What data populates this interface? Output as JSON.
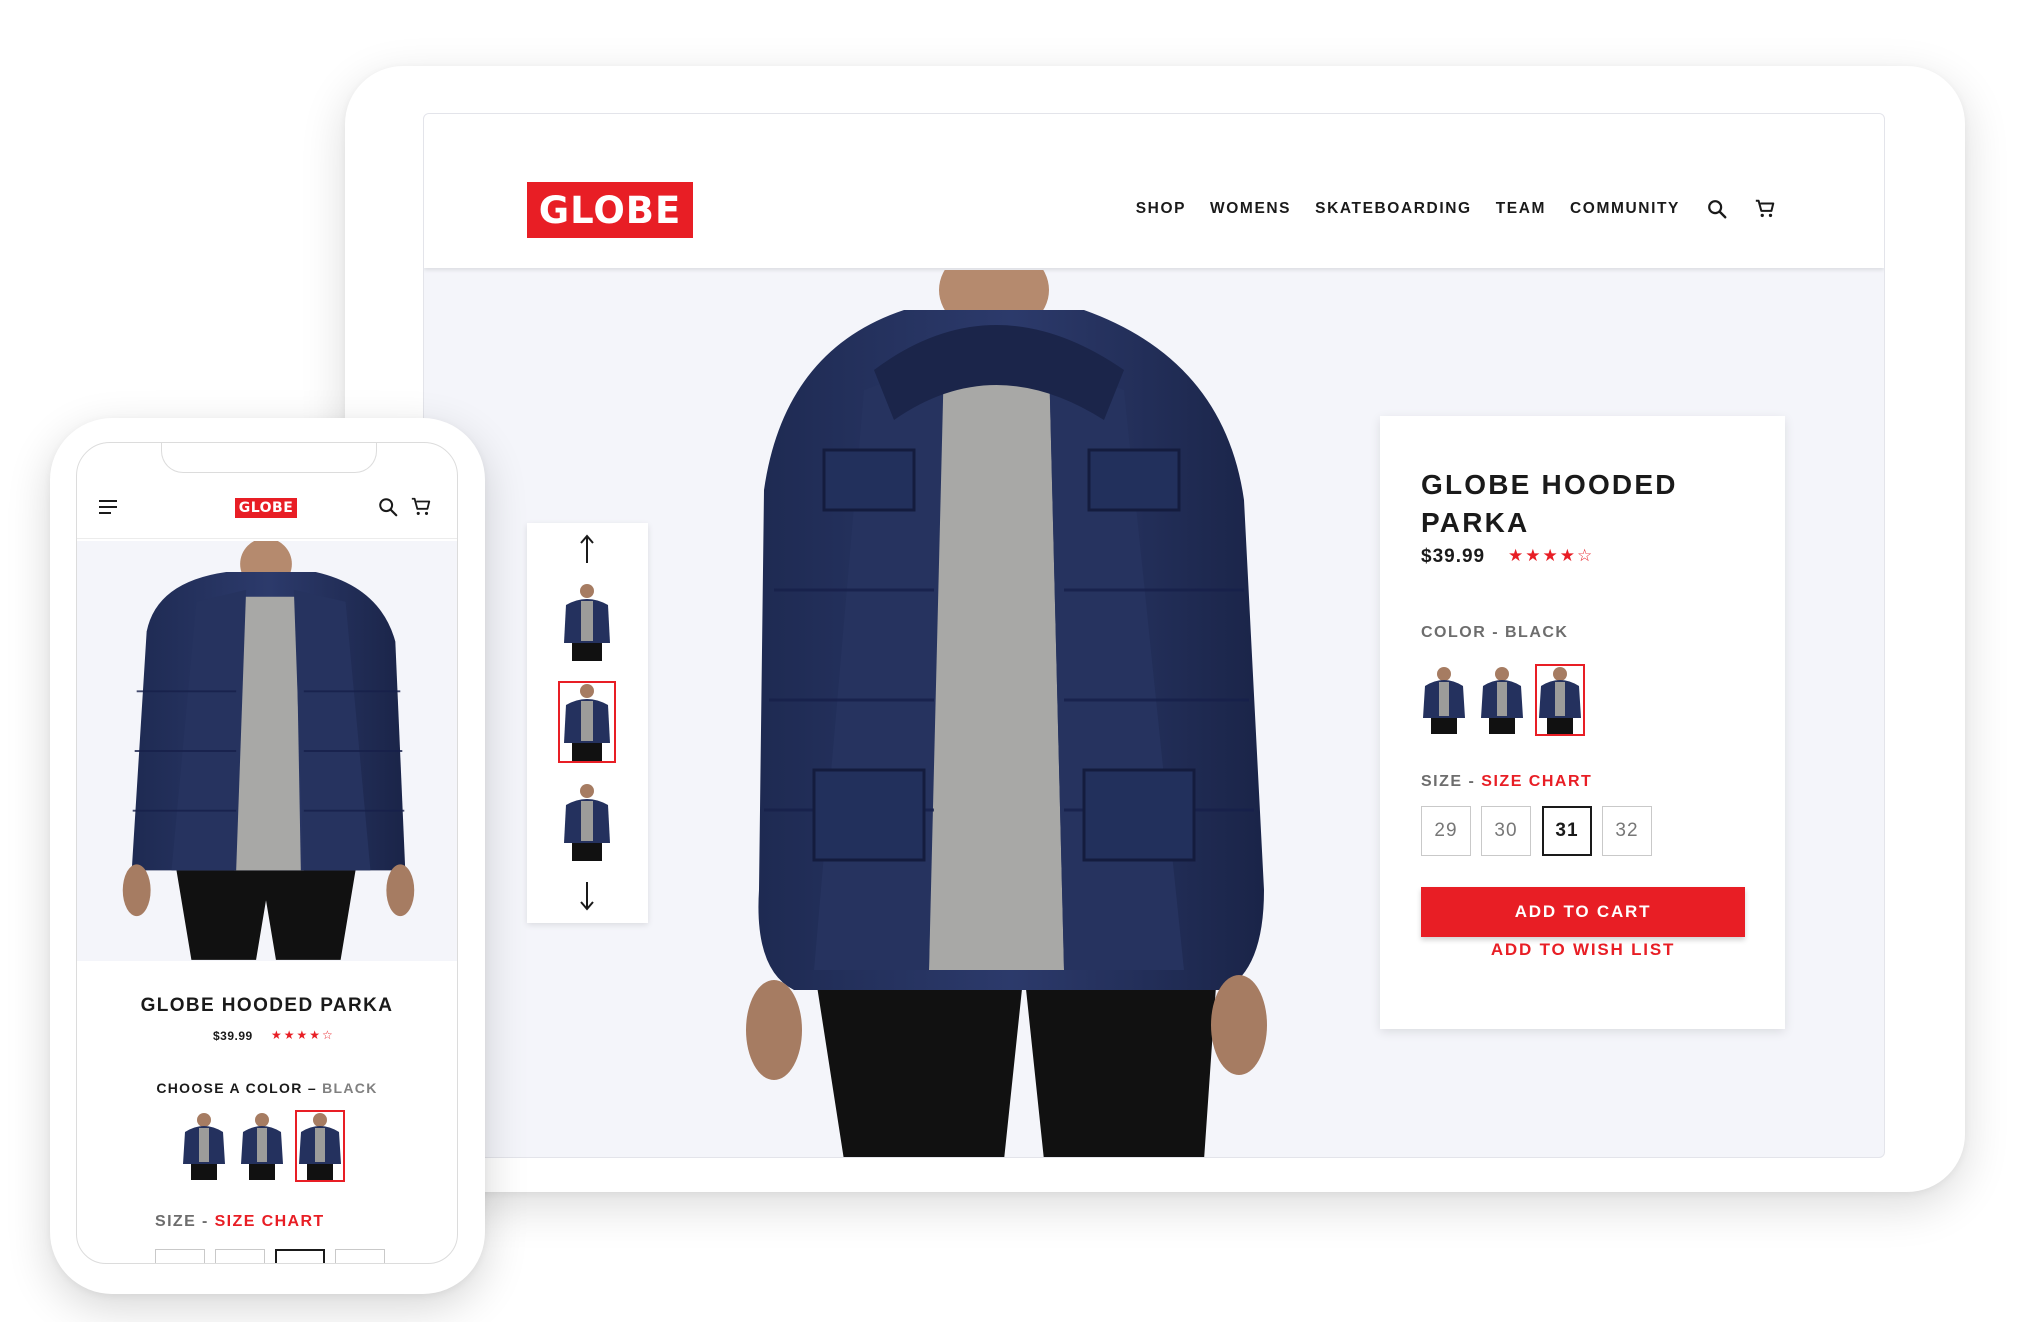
{
  "brand": {
    "logo_text": "GLOBE",
    "accent_color": "#e81e25"
  },
  "desktop": {
    "nav": {
      "items": [
        "SHOP",
        "WOMENS",
        "SKATEBOARDING",
        "TEAM",
        "COMMUNITY"
      ],
      "icons": [
        "search-icon",
        "cart-icon"
      ]
    },
    "thumbnail_rail": {
      "up_icon": "arrow-up-icon",
      "down_icon": "arrow-down-icon",
      "thumbnails": [
        "product-thumbnail-1",
        "product-thumbnail-2",
        "product-thumbnail-3"
      ],
      "selected_index": 1
    },
    "product": {
      "title": "GLOBE HOODED PARKA",
      "price": "$39.99",
      "rating": 3.5,
      "rating_max": 5,
      "stars_text": "★★★★☆",
      "color_label": "COLOR - BLACK",
      "color_swatches": [
        "swatch-1",
        "swatch-2",
        "swatch-3"
      ],
      "selected_color_index": 2,
      "size_label": "SIZE -",
      "size_chart_link": "SIZE CHART",
      "sizes": [
        "29",
        "30",
        "31",
        "32"
      ],
      "selected_size": "31",
      "add_to_cart": "ADD TO CART",
      "add_to_wish_list": "ADD TO WISH LIST"
    }
  },
  "mobile": {
    "header_icons": [
      "menu-icon",
      "search-icon",
      "cart-icon"
    ],
    "product": {
      "title": "GLOBE HOODED PARKA",
      "price": "$39.99",
      "stars_text": "★★★★☆",
      "color_label_prefix": "CHOOSE A COLOR –",
      "color_value": "BLACK",
      "selected_color_index": 2,
      "size_label": "SIZE -",
      "size_chart_link": "SIZE CHART"
    }
  }
}
